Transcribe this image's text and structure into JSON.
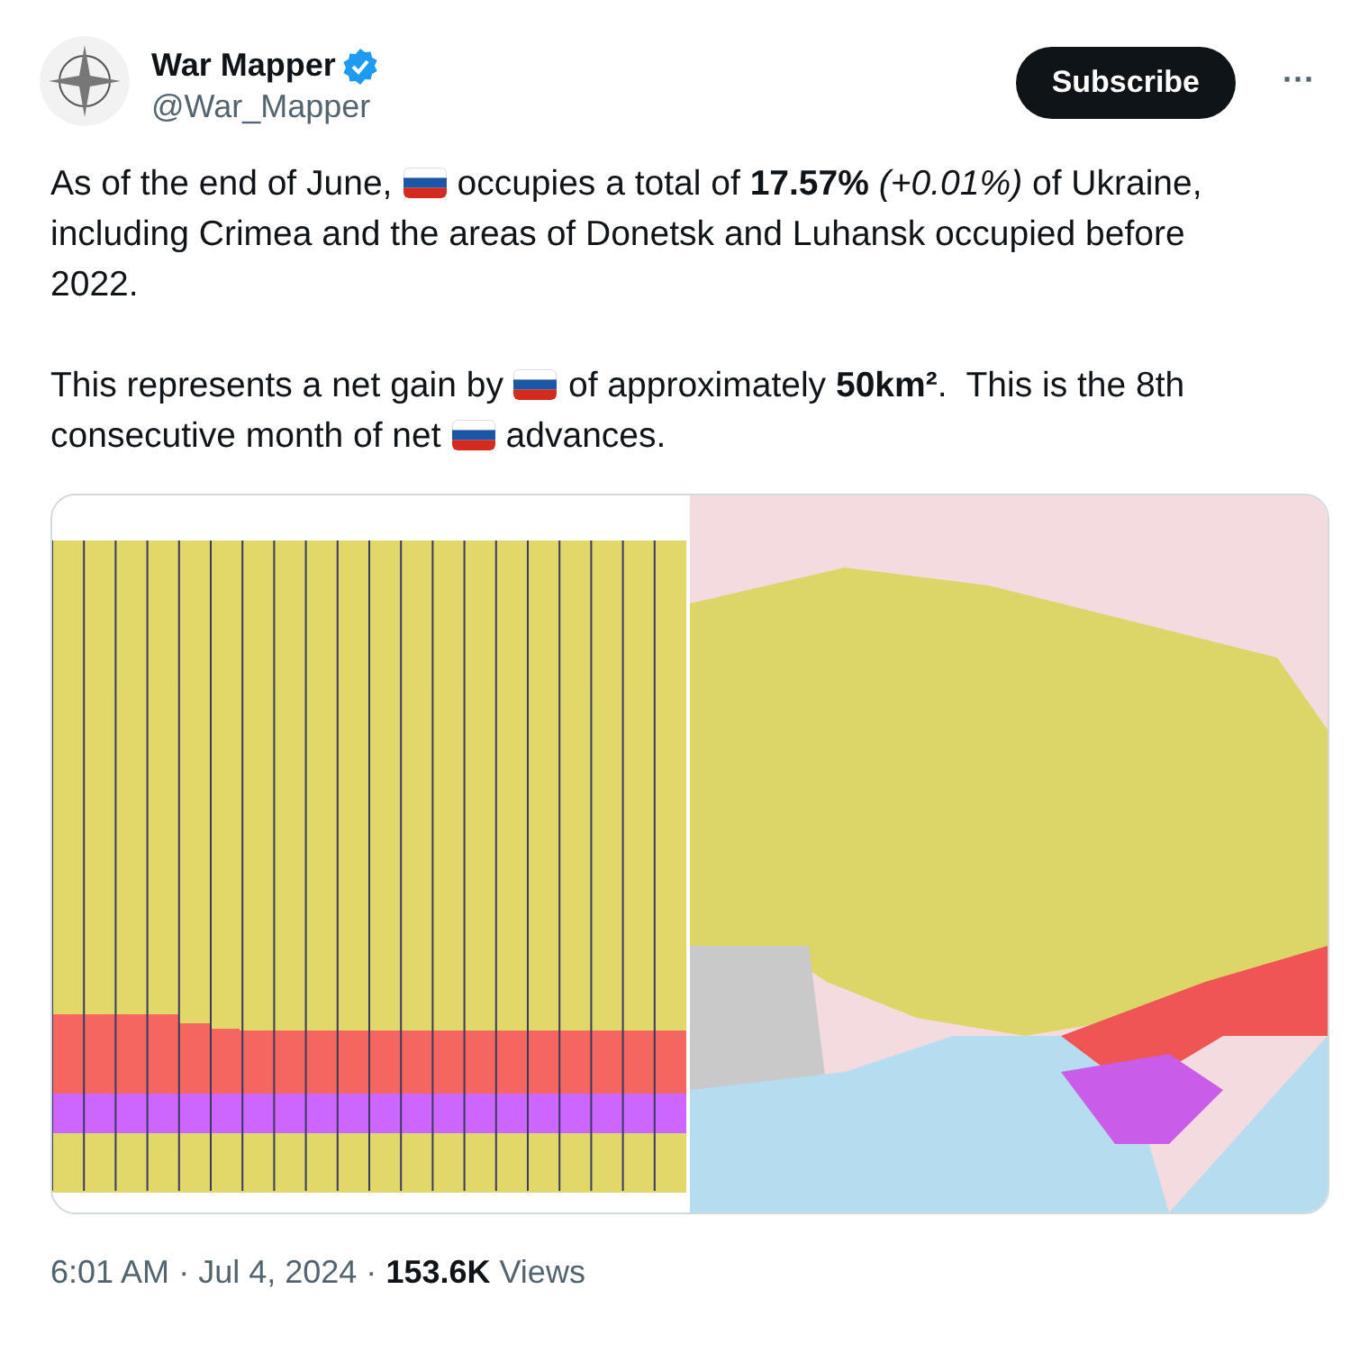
{
  "author": {
    "name": "War Mapper",
    "verified": true,
    "handle": "@War_Mapper"
  },
  "subscribe_button": "Subscribe",
  "more_button": "···",
  "paragraphs": [
    [
      {
        "kind": "text",
        "text": "As of the end of June,"
      },
      {
        "kind": "flag"
      },
      {
        "kind": "text",
        "text": "occupies a total of **17.57%** *(+0.01%)* of Ukraine,"
      },
      {
        "kind": "break"
      },
      {
        "kind": "text",
        "text": "including Crimea and the areas of Donetsk and Luhansk occupied before"
      },
      {
        "kind": "break"
      },
      {
        "kind": "text",
        "text": "2022."
      }
    ],
    [
      {
        "kind": "text",
        "text": "This represents a net gain by"
      },
      {
        "kind": "flag"
      },
      {
        "kind": "text",
        "text": "of approximately **50km²**.  This is the 8th"
      },
      {
        "kind": "break"
      },
      {
        "kind": "text",
        "text": "consecutive month of net"
      },
      {
        "kind": "flag"
      },
      {
        "kind": "text",
        "text": "advances."
      }
    ]
  ],
  "meta": {
    "time": "6:01 AM",
    "separator": "·",
    "date": "Jul 4, 2024",
    "views_count": "153.6K",
    "views_label": "Views"
  }
}
